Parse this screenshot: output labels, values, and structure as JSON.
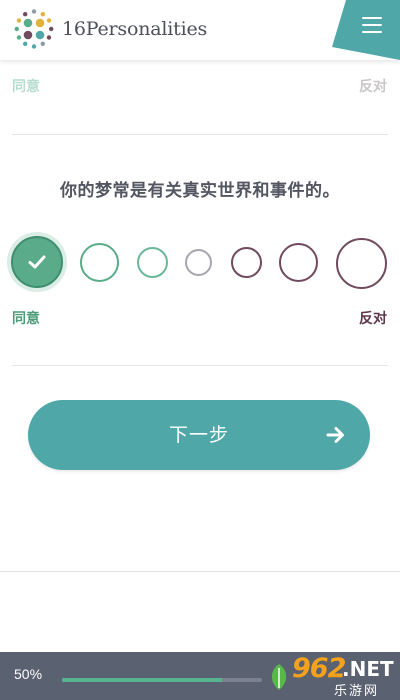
{
  "header": {
    "brand": "16Personalities",
    "menu_icon": "hamburger-icon",
    "colors": {
      "accent": "#4fa7a8",
      "logo_text": "#4d4f5a"
    }
  },
  "previous_question": {
    "agree_label": "同意",
    "disagree_label": "反对"
  },
  "question": {
    "text": "你的梦常是有关真实世界和事件的。",
    "agree_label": "同意",
    "disagree_label": "反对",
    "selected_index": 0,
    "option_count": 7,
    "option_colors": [
      "#5aab8a",
      "#5aab8a",
      "#6cb79a",
      "#a7a5ad",
      "#6f4b5d",
      "#6f4b5d",
      "#6f4b5d"
    ]
  },
  "next_button": {
    "label": "下一步",
    "icon": "arrow-right-icon"
  },
  "progress": {
    "label": "50%",
    "fraction": 0.8,
    "colors": {
      "fill": "#58b48f",
      "bar": "#5a6170"
    }
  },
  "watermark": {
    "number": "962",
    "suffix": ".NET",
    "site_name": "乐游网"
  }
}
